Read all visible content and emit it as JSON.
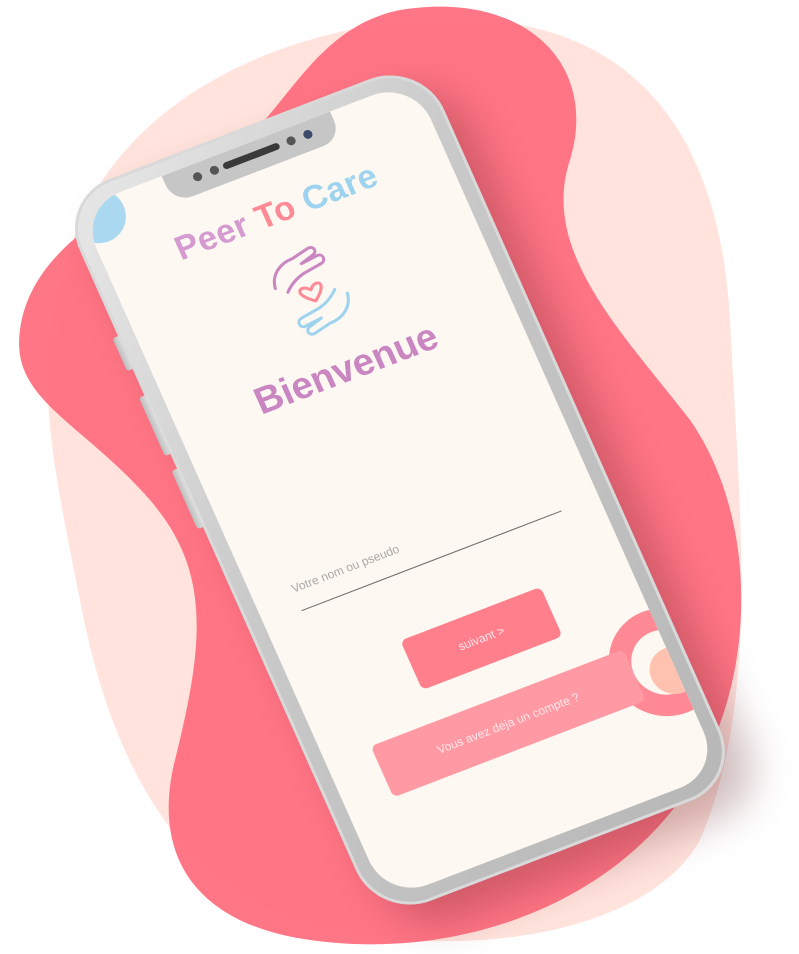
{
  "app": {
    "title_part1": "Peer",
    "title_part2": "To",
    "title_part3": "Care",
    "logo_icon": "hands-heart-icon"
  },
  "welcome": {
    "heading": "Bienvenue"
  },
  "form": {
    "name_placeholder": "Votre nom ou pseudo",
    "next_label": "suivant >",
    "account_label": "Vous avez deja un compte ?"
  },
  "colors": {
    "background_blob_light": "#ffe3dc",
    "background_blob_strong": "#ff6b7d",
    "screen_background": "#fdf8f1",
    "title_pink": "#d59ad0",
    "title_coral": "#ff8a95",
    "title_blue": "#9ed3ef",
    "welcome_purple": "#c986c1",
    "button_primary": "#ff7f8c",
    "button_secondary": "#ff9aa4"
  }
}
